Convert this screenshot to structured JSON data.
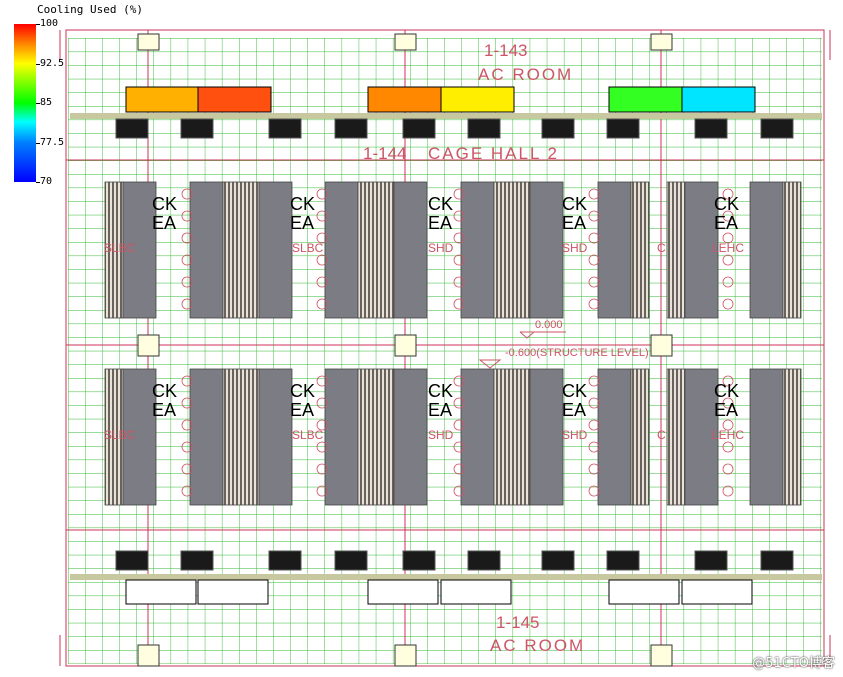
{
  "legend": {
    "title": "Cooling Used (%)",
    "ticks": [
      "100",
      "92.5",
      "85",
      "77.5",
      "70"
    ]
  },
  "rooms": {
    "top_id": "1-143",
    "top_name": "AC ROOM",
    "middle_id": "1-144",
    "middle_name": "CAGE HALL 2",
    "bottom_id": "1-145",
    "bottom_name": "AC ROOM"
  },
  "level": {
    "value": "0.000",
    "structure": "-0.600(STRUCTURE LEVEL)"
  },
  "cooling_units": {
    "top": [
      {
        "color": "#ffb000"
      },
      {
        "color": "#ff5010"
      },
      {
        "color": "#ff8800"
      },
      {
        "color": "#ffee00"
      },
      {
        "color": "#33ff22"
      },
      {
        "color": "#00e5ff"
      }
    ],
    "bottom": [
      {
        "color": "#ffffff"
      },
      {
        "color": "#ffffff"
      },
      {
        "color": "#ffffff"
      },
      {
        "color": "#ffffff"
      },
      {
        "color": "#ffffff"
      },
      {
        "color": "#ffffff"
      }
    ]
  },
  "rack_labels": {
    "top_a": "CK",
    "top_b": "EA",
    "side": [
      "SLBC",
      "SLBC",
      "SHD",
      "SHD",
      "C",
      "LEHC"
    ]
  },
  "watermark": "@51CTO博客"
}
